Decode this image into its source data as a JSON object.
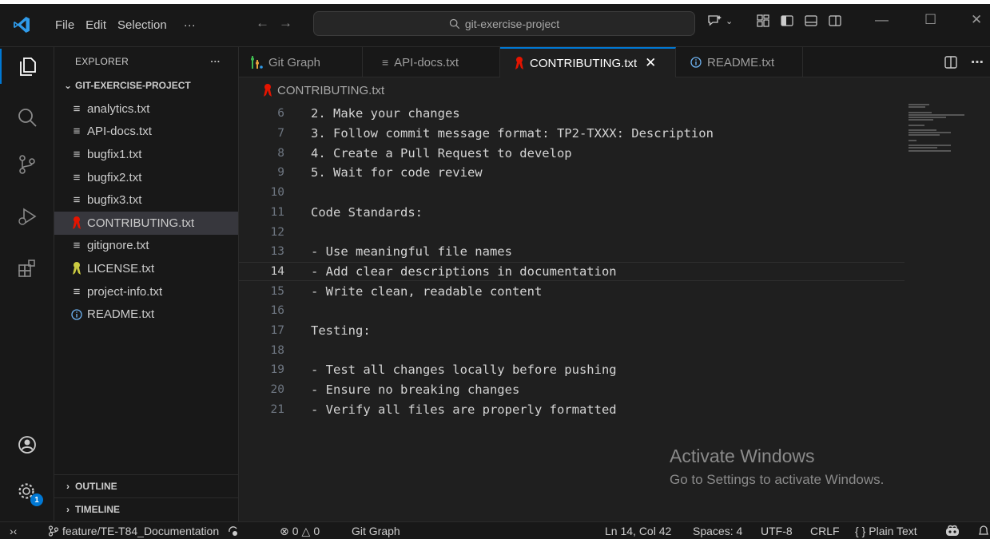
{
  "titlebar": {
    "menu": [
      "File",
      "Edit",
      "Selection",
      "···"
    ],
    "search_text": "git-exercise-project"
  },
  "sidebar": {
    "title": "EXPLORER",
    "more": "···",
    "project": "GIT-EXERCISE-PROJECT",
    "files": [
      {
        "name": "analytics.txt",
        "icon": "lines-file-icon"
      },
      {
        "name": "API-docs.txt",
        "icon": "lines-file-icon"
      },
      {
        "name": "bugfix1.txt",
        "icon": "lines-file-icon"
      },
      {
        "name": "bugfix2.txt",
        "icon": "lines-file-icon"
      },
      {
        "name": "bugfix3.txt",
        "icon": "lines-file-icon"
      },
      {
        "name": "CONTRIBUTING.txt",
        "icon": "ribbon-file-icon"
      },
      {
        "name": "gitignore.txt",
        "icon": "lines-file-icon"
      },
      {
        "name": "LICENSE.txt",
        "icon": "license-file-icon"
      },
      {
        "name": "project-info.txt",
        "icon": "lines-file-icon"
      },
      {
        "name": "README.txt",
        "icon": "info-file-icon"
      }
    ],
    "selected_index": 5,
    "outline": "OUTLINE",
    "timeline": "TIMELINE"
  },
  "tabs": [
    {
      "label": "Git Graph",
      "icon": "git-graph-icon"
    },
    {
      "label": "API-docs.txt",
      "icon": "lines-file-icon"
    },
    {
      "label": "CONTRIBUTING.txt",
      "icon": "ribbon-file-icon",
      "active": true
    },
    {
      "label": "README.txt",
      "icon": "info-file-icon"
    }
  ],
  "breadcrumb": "CONTRIBUTING.txt",
  "editor": {
    "current_line": 14,
    "lines": [
      {
        "n": "6",
        "text": "2. Make your changes"
      },
      {
        "n": "7",
        "text": "3. Follow commit message format: TP2-TXXX: Description"
      },
      {
        "n": "8",
        "text": "4. Create a Pull Request to develop"
      },
      {
        "n": "9",
        "text": "5. Wait for code review"
      },
      {
        "n": "10",
        "text": ""
      },
      {
        "n": "11",
        "text": "Code Standards:"
      },
      {
        "n": "12",
        "text": ""
      },
      {
        "n": "13",
        "text": "- Use meaningful file names"
      },
      {
        "n": "14",
        "text": "- Add clear descriptions in documentation"
      },
      {
        "n": "15",
        "text": "- Write clean, readable content"
      },
      {
        "n": "16",
        "text": ""
      },
      {
        "n": "17",
        "text": "Testing:"
      },
      {
        "n": "18",
        "text": ""
      },
      {
        "n": "19",
        "text": "- Test all changes locally before pushing"
      },
      {
        "n": "20",
        "text": "- Ensure no breaking changes"
      },
      {
        "n": "21",
        "text": "- Verify all files are properly formatted"
      }
    ]
  },
  "watermark": {
    "title": "Activate Windows",
    "subtitle": "Go to Settings to activate Windows."
  },
  "statusbar": {
    "branch": "feature/TE-T84_Documentation",
    "errors": "0",
    "warnings": "0",
    "git_graph": "Git Graph",
    "position": "Ln 14, Col 42",
    "spaces": "Spaces: 4",
    "encoding": "UTF-8",
    "eol": "CRLF",
    "language": "Plain Text",
    "braces": "{ }"
  },
  "badges": {
    "accounts_settings": "1"
  },
  "colors": {
    "accent": "#0078d4",
    "ribbon": "#e51400",
    "license": "#cbcb41",
    "git_graph_green": "#3fb950"
  }
}
